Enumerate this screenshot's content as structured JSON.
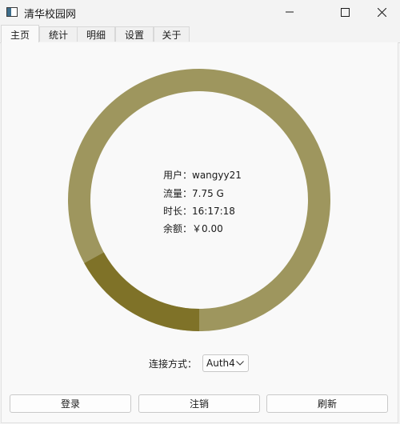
{
  "window": {
    "title": "清华校园网",
    "icons": {
      "app": "window-app-icon",
      "minimize": "minimize-icon",
      "maximize": "maximize-icon",
      "close": "close-icon"
    }
  },
  "tabs": [
    {
      "label": "主页",
      "active": true
    },
    {
      "label": "统计",
      "active": false
    },
    {
      "label": "明细",
      "active": false
    },
    {
      "label": "设置",
      "active": false
    },
    {
      "label": "关于",
      "active": false
    }
  ],
  "usage_ring": {
    "used_fraction": 0.17,
    "colors": {
      "remaining": "#9e965e",
      "used": "#7f7228"
    }
  },
  "account": {
    "user_label": "用户：",
    "user_value": "wangyy21",
    "flux_label": "流量：",
    "flux_value": "7.75 G",
    "time_label": "时长：",
    "time_value": "16:17:18",
    "balance_label": "余额：",
    "balance_value": "￥0.00"
  },
  "connection": {
    "label": "连接方式：",
    "selected": "Auth4"
  },
  "buttons": {
    "login": "登录",
    "logout": "注销",
    "refresh": "刷新"
  }
}
